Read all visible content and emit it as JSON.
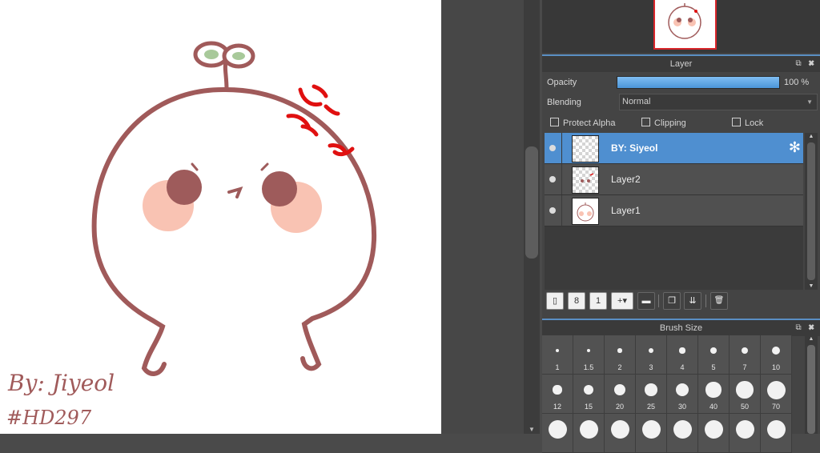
{
  "canvas": {
    "signature": "By: Jiyeol",
    "tag": "#HD297",
    "colors": {
      "outline": "#a05a5a",
      "blush": "#f9c3b3",
      "eye": "#9e5b5b",
      "leaf": "#a8c99a",
      "anger": "#e01010"
    }
  },
  "scroll": {
    "up": "▲",
    "down": "▼"
  },
  "layer_panel": {
    "title": "Layer",
    "header_icons": "⧉ ✖",
    "opacity": {
      "label": "Opacity",
      "value": "100 %",
      "fraction": 1.0
    },
    "blending": {
      "label": "Blending",
      "value": "Normal"
    },
    "options": [
      {
        "label": "Protect Alpha",
        "checked": false
      },
      {
        "label": "Clipping",
        "checked": false
      },
      {
        "label": "Lock",
        "checked": false
      }
    ],
    "layers": [
      {
        "name": "BY: Siyeol",
        "selected": true,
        "gear": "✻"
      },
      {
        "name": "Layer2",
        "selected": false
      },
      {
        "name": "Layer1",
        "selected": false
      }
    ],
    "toolbar": [
      {
        "name": "new-layer-button",
        "icon": "page-icon",
        "glyph": "▯"
      },
      {
        "name": "new-8bit-layer-button",
        "icon": "page-8-icon",
        "glyph": "8"
      },
      {
        "name": "new-1bit-layer-button",
        "icon": "page-1-icon",
        "glyph": "1"
      },
      {
        "name": "add-layer-menu-button",
        "icon": "page-plus-icon",
        "glyph": "+▾"
      },
      {
        "name": "new-folder-button",
        "icon": "folder-icon",
        "glyph": "▬"
      },
      {
        "name": "duplicate-layer-button",
        "icon": "copy-icon",
        "glyph": "❐"
      },
      {
        "name": "merge-layer-button",
        "icon": "merge-icon",
        "glyph": "⇊"
      },
      {
        "name": "delete-layer-button",
        "icon": "trash-icon",
        "glyph": "🗑"
      }
    ]
  },
  "brush_panel": {
    "title": "Brush Size",
    "header_icons": "⧉ ✖",
    "sizes": [
      "1",
      "1.5",
      "2",
      "3",
      "4",
      "5",
      "7",
      "10",
      "12",
      "15",
      "20",
      "25",
      "30",
      "40",
      "50",
      "70"
    ]
  }
}
